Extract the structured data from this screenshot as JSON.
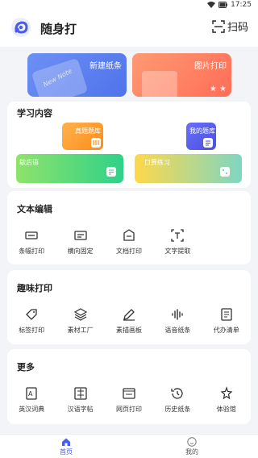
{
  "status_bar": {
    "time": "17:25"
  },
  "header": {
    "app_title": "随身打",
    "scan_label": "扫码"
  },
  "top_cards": [
    {
      "label": "新建纸条",
      "deco_text": "New Note"
    },
    {
      "label": "图片打印"
    }
  ],
  "study": {
    "title": "学习内容",
    "tiles": {
      "zhenti": "真题题库",
      "mine": "我的题库",
      "xiehou": "歇后语",
      "kousuan": "口算练习"
    }
  },
  "text_edit": {
    "title": "文本编辑",
    "items": [
      {
        "label": "条幅打印",
        "icon": "banner-icon"
      },
      {
        "label": "横向固定",
        "icon": "landscape-icon"
      },
      {
        "label": "文档打印",
        "icon": "document-icon"
      },
      {
        "label": "文字提取",
        "icon": "text-extract-icon"
      }
    ]
  },
  "fun_print": {
    "title": "趣味打印",
    "items": [
      {
        "label": "标签打印",
        "icon": "tag-icon"
      },
      {
        "label": "素材工厂",
        "icon": "layers-icon"
      },
      {
        "label": "素描画板",
        "icon": "pencil-icon"
      },
      {
        "label": "语音纸条",
        "icon": "voice-icon"
      },
      {
        "label": "代办清单",
        "icon": "checklist-icon"
      }
    ]
  },
  "more": {
    "title": "更多",
    "items": [
      {
        "label": "英汉词典",
        "icon": "dictionary-icon"
      },
      {
        "label": "汉语字帖",
        "icon": "calligraphy-icon"
      },
      {
        "label": "网页打印",
        "icon": "webpage-icon"
      },
      {
        "label": "历史纸条",
        "icon": "history-icon"
      },
      {
        "label": "体验馆",
        "icon": "experience-icon"
      }
    ]
  },
  "bottom_nav": {
    "home": "首页",
    "mine": "我的"
  },
  "colors": {
    "accent": "#4a5de8",
    "note_card": "#5b7ff0",
    "image_card": "#ff7a5c"
  }
}
